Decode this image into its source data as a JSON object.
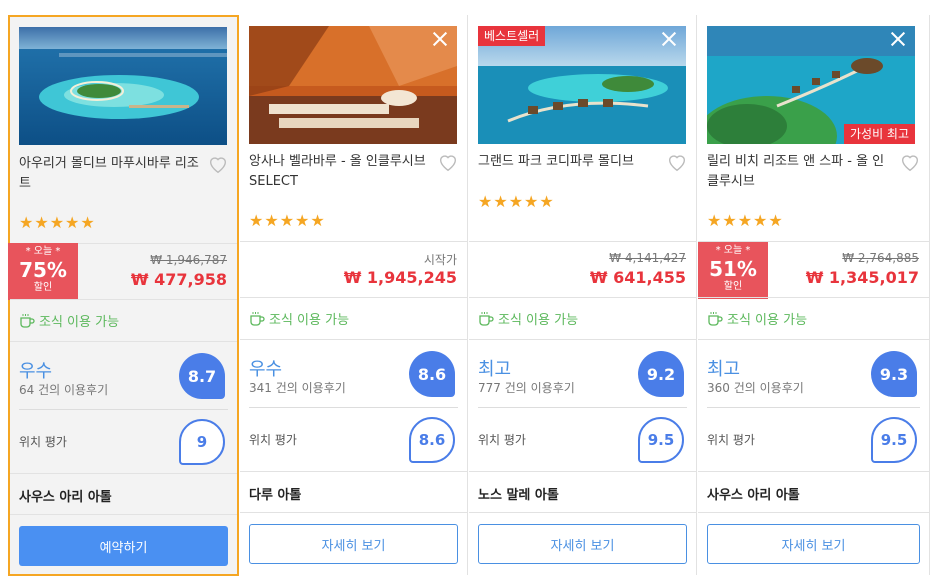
{
  "cards": [
    {
      "name": "아우리거 몰디브 마푸시바루 리조트",
      "stars": "★★★★★",
      "discount": {
        "today": "* 오늘 *",
        "pct": "75%",
        "off": "할인"
      },
      "price_old": "₩ 1,946,787",
      "price_new": "₩ 477,958",
      "breakfast": "조식 이용 가능",
      "rating_word": "우수",
      "review_count": "64 건의 이용후기",
      "score": "8.7",
      "loc_label": "위치 평가",
      "loc_score": "9",
      "area": "사우스 아리 아톨",
      "button": "예약하기"
    },
    {
      "name": "앙사나 벨라바루 - 올 인클루시브 SELECT",
      "stars": "★★★★★",
      "price_label": "시작가",
      "price_new": "₩ 1,945,245",
      "breakfast": "조식 이용 가능",
      "rating_word": "우수",
      "review_count": "341 건의 이용후기",
      "score": "8.6",
      "loc_label": "위치 평가",
      "loc_score": "8.6",
      "area": "다루 아톨",
      "button": "자세히 보기"
    },
    {
      "tag": "베스트셀러",
      "name": "그랜드 파크 코디파루 몰디브",
      "stars": "★★★★★",
      "price_old": "₩ 4,141,427",
      "price_new": "₩ 641,455",
      "breakfast": "조식 이용 가능",
      "rating_word": "최고",
      "review_count": "777 건의 이용후기",
      "score": "9.2",
      "loc_label": "위치 평가",
      "loc_score": "9.5",
      "area": "노스 말레 아톨",
      "button": "자세히 보기"
    },
    {
      "tag": "가성비 최고",
      "name": "릴리 비치 리조트 앤 스파 - 올 인클루시브",
      "stars": "★★★★★",
      "discount": {
        "today": "* 오늘 *",
        "pct": "51%",
        "off": "할인"
      },
      "price_old": "₩ 2,764,885",
      "price_new": "₩ 1,345,017",
      "breakfast": "조식 이용 가능",
      "rating_word": "최고",
      "review_count": "360 건의 이용후기",
      "score": "9.3",
      "loc_label": "위치 평가",
      "loc_score": "9.5",
      "area": "사우스 아리 아톨",
      "button": "자세히 보기"
    }
  ],
  "colors": {
    "accent_blue": "#4a90e2",
    "price_red": "#e8343c",
    "discount_red": "#e8545c",
    "selected_border": "#f5a623",
    "breakfast_green": "#5cb85c"
  }
}
